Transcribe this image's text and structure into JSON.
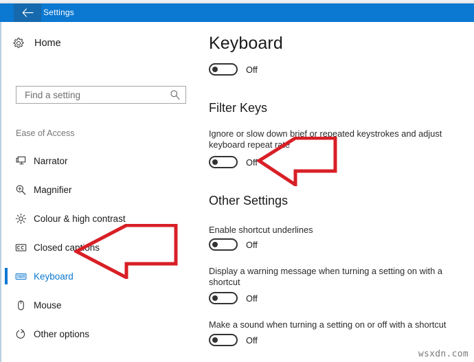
{
  "window": {
    "title": "Settings",
    "back_icon": "back-arrow-icon",
    "titlebar_color": "#0b78d1"
  },
  "sidebar": {
    "home": {
      "label": "Home",
      "icon": "gear-icon"
    },
    "search": {
      "placeholder": "Find a setting",
      "value": "",
      "icon": "search-icon"
    },
    "section_heading": "Ease of Access",
    "items": [
      {
        "label": "Narrator",
        "icon": "narrator-monitor-icon",
        "selected": false
      },
      {
        "label": "Magnifier",
        "icon": "magnifier-icon",
        "selected": false
      },
      {
        "label": "Colour & high contrast",
        "icon": "brightness-sun-icon",
        "selected": false
      },
      {
        "label": "Closed captions",
        "icon": "closed-captions-icon",
        "selected": false
      },
      {
        "label": "Keyboard",
        "icon": "keyboard-icon",
        "selected": true
      },
      {
        "label": "Mouse",
        "icon": "mouse-icon",
        "selected": false
      },
      {
        "label": "Other options",
        "icon": "power-options-icon",
        "selected": false
      }
    ],
    "selected_accent_color": "#0b78d1"
  },
  "content": {
    "page_title": "Keyboard",
    "on_screen_keyboard_toggle": {
      "state_label": "Off",
      "on": false
    },
    "filter_keys": {
      "title": "Filter Keys",
      "description": "Ignore or slow down brief or repeated keystrokes and adjust keyboard repeat rate",
      "toggle": {
        "state_label": "Off",
        "on": false
      }
    },
    "other_settings": {
      "title": "Other Settings",
      "settings": [
        {
          "description": "Enable shortcut underlines",
          "toggle": {
            "state_label": "Off",
            "on": false
          }
        },
        {
          "description": "Display a warning message when turning a setting on with a shortcut",
          "toggle": {
            "state_label": "Off",
            "on": false
          }
        },
        {
          "description": "Make a sound when turning a setting on or off with a shortcut",
          "toggle": {
            "state_label": "Off",
            "on": false
          }
        }
      ]
    }
  },
  "annotations": {
    "arrow_color": "#d81f26",
    "arrows": [
      {
        "name": "arrow-pointing-to-keyboard-nav-item",
        "direction": "left"
      },
      {
        "name": "arrow-pointing-to-filter-keys-toggle",
        "direction": "left"
      }
    ]
  },
  "watermark": {
    "text": "wsxdn.com"
  }
}
